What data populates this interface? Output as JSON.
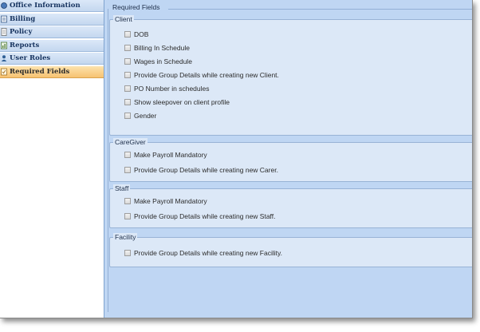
{
  "sidebar": {
    "items": [
      {
        "label": "Office Information",
        "icon": "office-icon"
      },
      {
        "label": "Billing",
        "icon": "billing-icon"
      },
      {
        "label": "Policy",
        "icon": "policy-icon"
      },
      {
        "label": "Reports",
        "icon": "reports-icon"
      },
      {
        "label": "User Roles",
        "icon": "user-roles-icon"
      },
      {
        "label": "Required Fields",
        "icon": "required-fields-icon",
        "active": true
      }
    ]
  },
  "main": {
    "title": "Required Fields",
    "groups": {
      "client": {
        "title": "Client",
        "options": [
          "DOB",
          "Billing In Schedule",
          "Wages in Schedule",
          "Provide Group Details while creating new Client.",
          "PO Number in schedules",
          "Show sleepover on client profile",
          "Gender"
        ]
      },
      "caregiver": {
        "title": "CareGiver",
        "options": [
          "Make Payroll Mandatory",
          "Provide Group Details while creating new Carer."
        ]
      },
      "staff": {
        "title": "Staff",
        "options": [
          "Make Payroll Mandatory",
          "Provide Group Details while creating new Staff."
        ]
      },
      "facility": {
        "title": "Facility",
        "options": [
          "Provide Group Details while creating new Facility."
        ]
      }
    }
  },
  "colors": {
    "panel_bg": "#bfd6f3",
    "group_bg": "#dce8f7",
    "active_item": "#f7c271",
    "nav_text": "#15325e"
  }
}
